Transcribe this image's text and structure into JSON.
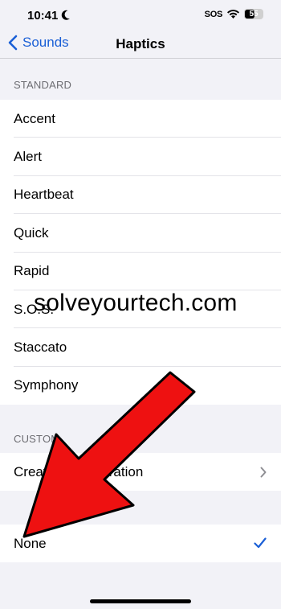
{
  "status_bar": {
    "time": "10:41",
    "sos": "SOS",
    "battery": "55"
  },
  "nav": {
    "back_label": "Sounds",
    "title": "Haptics"
  },
  "sections": {
    "standard_header": "STANDARD",
    "standard_items": [
      "Accent",
      "Alert",
      "Heartbeat",
      "Quick",
      "Rapid",
      "S.O.S.",
      "Staccato",
      "Symphony"
    ],
    "custom_header": "CUSTOM",
    "custom_item": "Create New Vibration",
    "none_item": "None"
  },
  "watermark": "solveyourtech.com",
  "colors": {
    "accent": "#1a5fd6",
    "annotation_arrow": "#ee1111",
    "background": "#f2f2f7"
  }
}
